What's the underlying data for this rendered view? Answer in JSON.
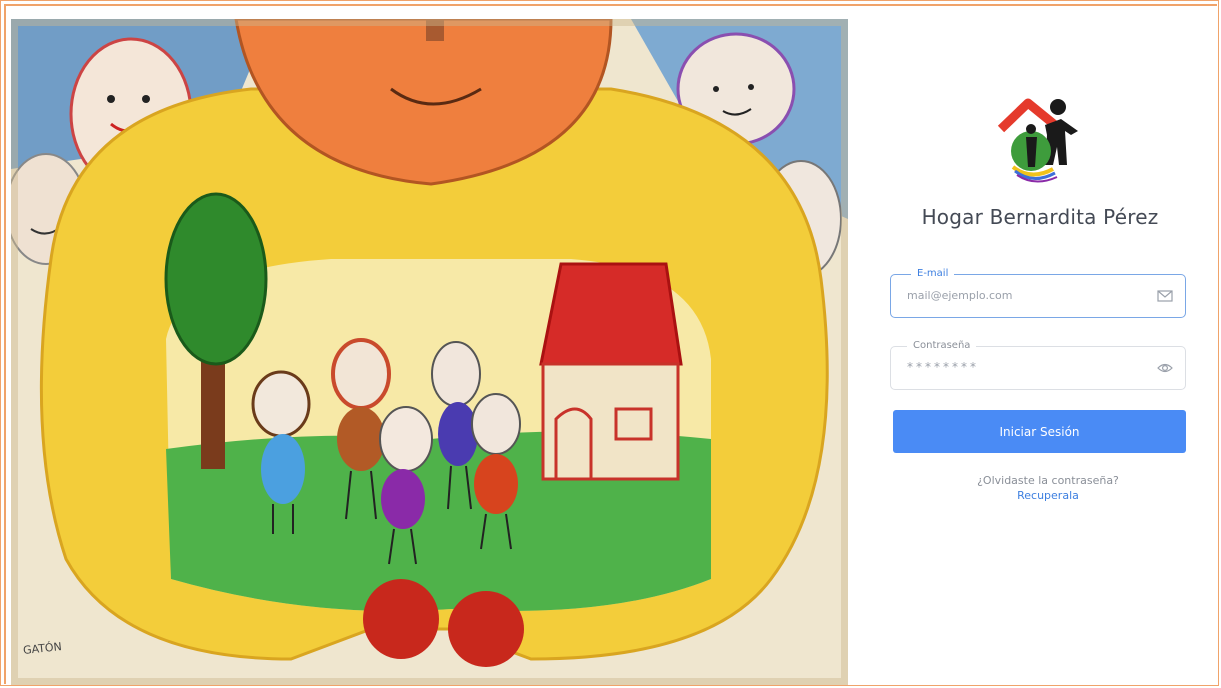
{
  "organization": {
    "name": "Hogar Bernardita Pérez",
    "logo_icon": "family-house-logo-icon"
  },
  "illustration": {
    "signature": "GATÓN"
  },
  "login_form": {
    "email": {
      "label": "E-mail",
      "placeholder": "mail@ejemplo.com",
      "icon": "envelope-icon"
    },
    "password": {
      "label": "Contraseña",
      "placeholder": "********",
      "icon": "eye-icon"
    },
    "submit_label": "Iniciar Sesión",
    "forgot_text": "¿Olvidaste la contraseña?",
    "recover_link": "Recuperala"
  },
  "colors": {
    "accent": "#4a8bf5",
    "frame_border": "#f0a36a",
    "title_text": "#444a55"
  }
}
